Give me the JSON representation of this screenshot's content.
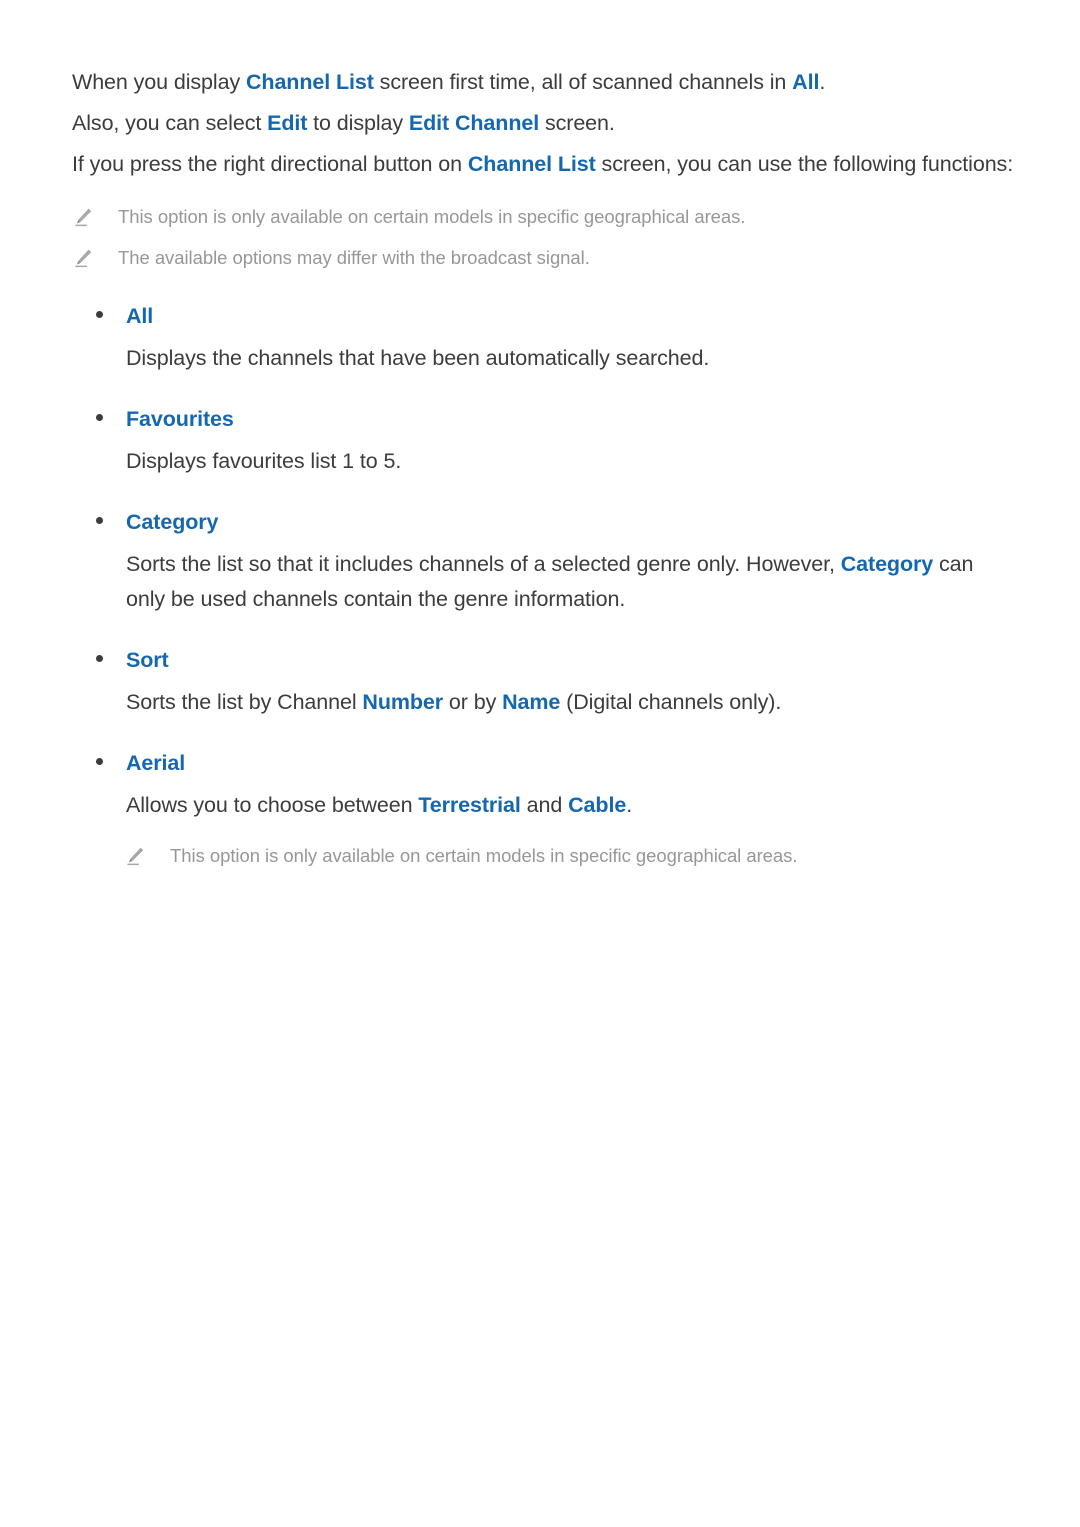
{
  "document": {
    "intro_paragraphs": [
      {
        "id": "para-1",
        "segments": [
          {
            "text": "When you display ",
            "style": "plain"
          },
          {
            "text": "Channel List",
            "style": "highlight"
          },
          {
            "text": " screen first time, all of scanned channels in ",
            "style": "plain"
          },
          {
            "text": "All",
            "style": "highlight"
          },
          {
            "text": ".",
            "style": "plain"
          }
        ]
      },
      {
        "id": "para-2",
        "segments": [
          {
            "text": "Also, you can select ",
            "style": "plain"
          },
          {
            "text": "Edit",
            "style": "highlight"
          },
          {
            "text": " to display ",
            "style": "plain"
          },
          {
            "text": "Edit Channel",
            "style": "highlight"
          },
          {
            "text": " screen.",
            "style": "plain"
          }
        ]
      },
      {
        "id": "para-3",
        "segments": [
          {
            "text": "If you press the right directional button on ",
            "style": "plain"
          },
          {
            "text": "Channel List",
            "style": "highlight"
          },
          {
            "text": " screen, you can use the following functions:",
            "style": "plain"
          }
        ]
      }
    ],
    "top_notes": [
      {
        "icon": "pencil-icon",
        "text": "This option is only available on certain models in specific geographical areas."
      },
      {
        "icon": "pencil-icon",
        "text": "The available options may differ with the broadcast signal."
      }
    ],
    "options": [
      {
        "title": "All",
        "body_segments": [
          {
            "text": "Displays the channels that have been automatically searched.",
            "style": "plain"
          }
        ],
        "notes": []
      },
      {
        "title": "Favourites",
        "body_segments": [
          {
            "text": "Displays favourites list 1 to 5.",
            "style": "plain"
          }
        ],
        "notes": []
      },
      {
        "title": "Category",
        "body_segments": [
          {
            "text": "Sorts the list so that it includes channels of a selected genre only. However, ",
            "style": "plain"
          },
          {
            "text": "Category",
            "style": "highlight"
          },
          {
            "text": " can only be used channels contain the genre information.",
            "style": "plain"
          }
        ],
        "notes": []
      },
      {
        "title": "Sort",
        "body_segments": [
          {
            "text": "Sorts the list by Channel ",
            "style": "plain"
          },
          {
            "text": "Number",
            "style": "highlight"
          },
          {
            "text": " or by ",
            "style": "plain"
          },
          {
            "text": "Name",
            "style": "highlight"
          },
          {
            "text": " (Digital channels only).",
            "style": "plain"
          }
        ],
        "notes": []
      },
      {
        "title": "Aerial",
        "body_segments": [
          {
            "text": "Allows you to choose between ",
            "style": "plain"
          },
          {
            "text": "Terrestrial",
            "style": "highlight"
          },
          {
            "text": " and ",
            "style": "plain"
          },
          {
            "text": "Cable",
            "style": "highlight"
          },
          {
            "text": ".",
            "style": "plain"
          }
        ],
        "notes": [
          {
            "icon": "pencil-icon",
            "text": "This option is only available on certain models in specific geographical areas."
          }
        ]
      }
    ],
    "colors": {
      "highlight": "#1568b0",
      "body_text": "#3c3c3c",
      "note_text": "#979797",
      "background": "#ffffff",
      "bullet": "#3c3c3c",
      "note_icon": "#a8a8a8"
    }
  }
}
